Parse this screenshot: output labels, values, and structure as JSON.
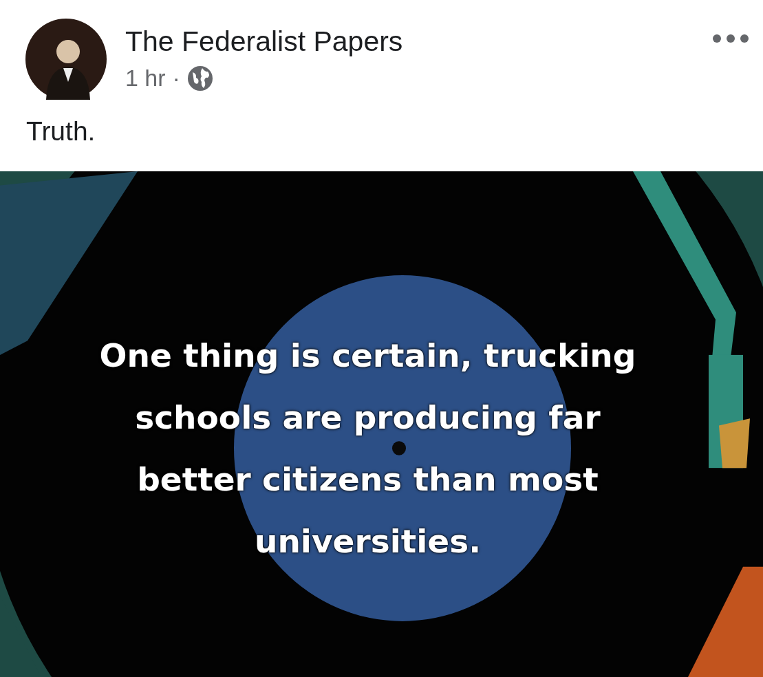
{
  "post": {
    "author": "The Federalist Papers",
    "time": "1 hr",
    "separator": "·",
    "text": "Truth.",
    "image": {
      "caption_lines": [
        "One thing is certain, trucking",
        "schools are producing far",
        "better citizens than most",
        "universities."
      ]
    }
  }
}
